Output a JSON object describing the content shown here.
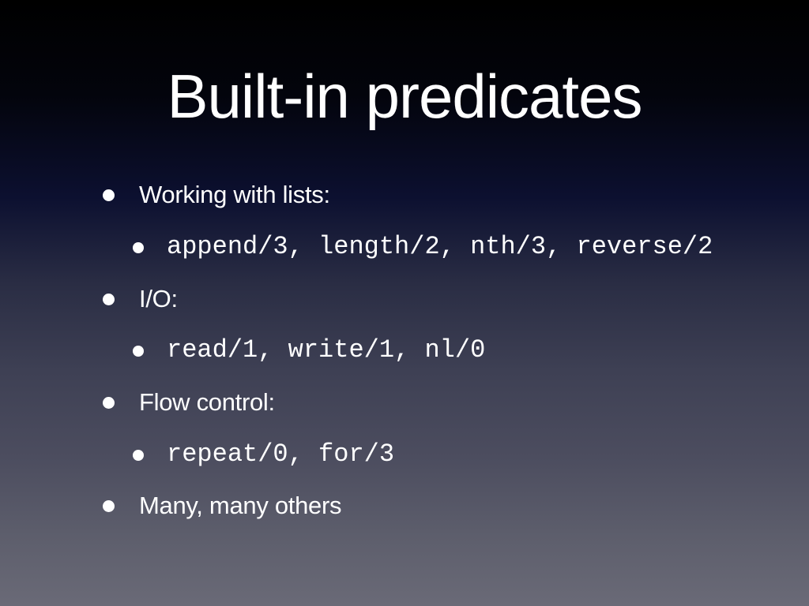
{
  "slide": {
    "title": "Built-in predicates",
    "bullets": [
      {
        "level": 1,
        "text": "Working with lists:"
      },
      {
        "level": 2,
        "text": "append/3, length/2, nth/3, reverse/2"
      },
      {
        "level": 1,
        "text": "I/O:"
      },
      {
        "level": 2,
        "text": "read/1, write/1, nl/0"
      },
      {
        "level": 1,
        "text": "Flow control:"
      },
      {
        "level": 2,
        "text": "repeat/0, for/3"
      },
      {
        "level": 1,
        "text": "Many, many others"
      }
    ]
  },
  "colors": {
    "text": "#ffffff",
    "background_top": "#000000",
    "background_bottom": "#6a6a77"
  }
}
